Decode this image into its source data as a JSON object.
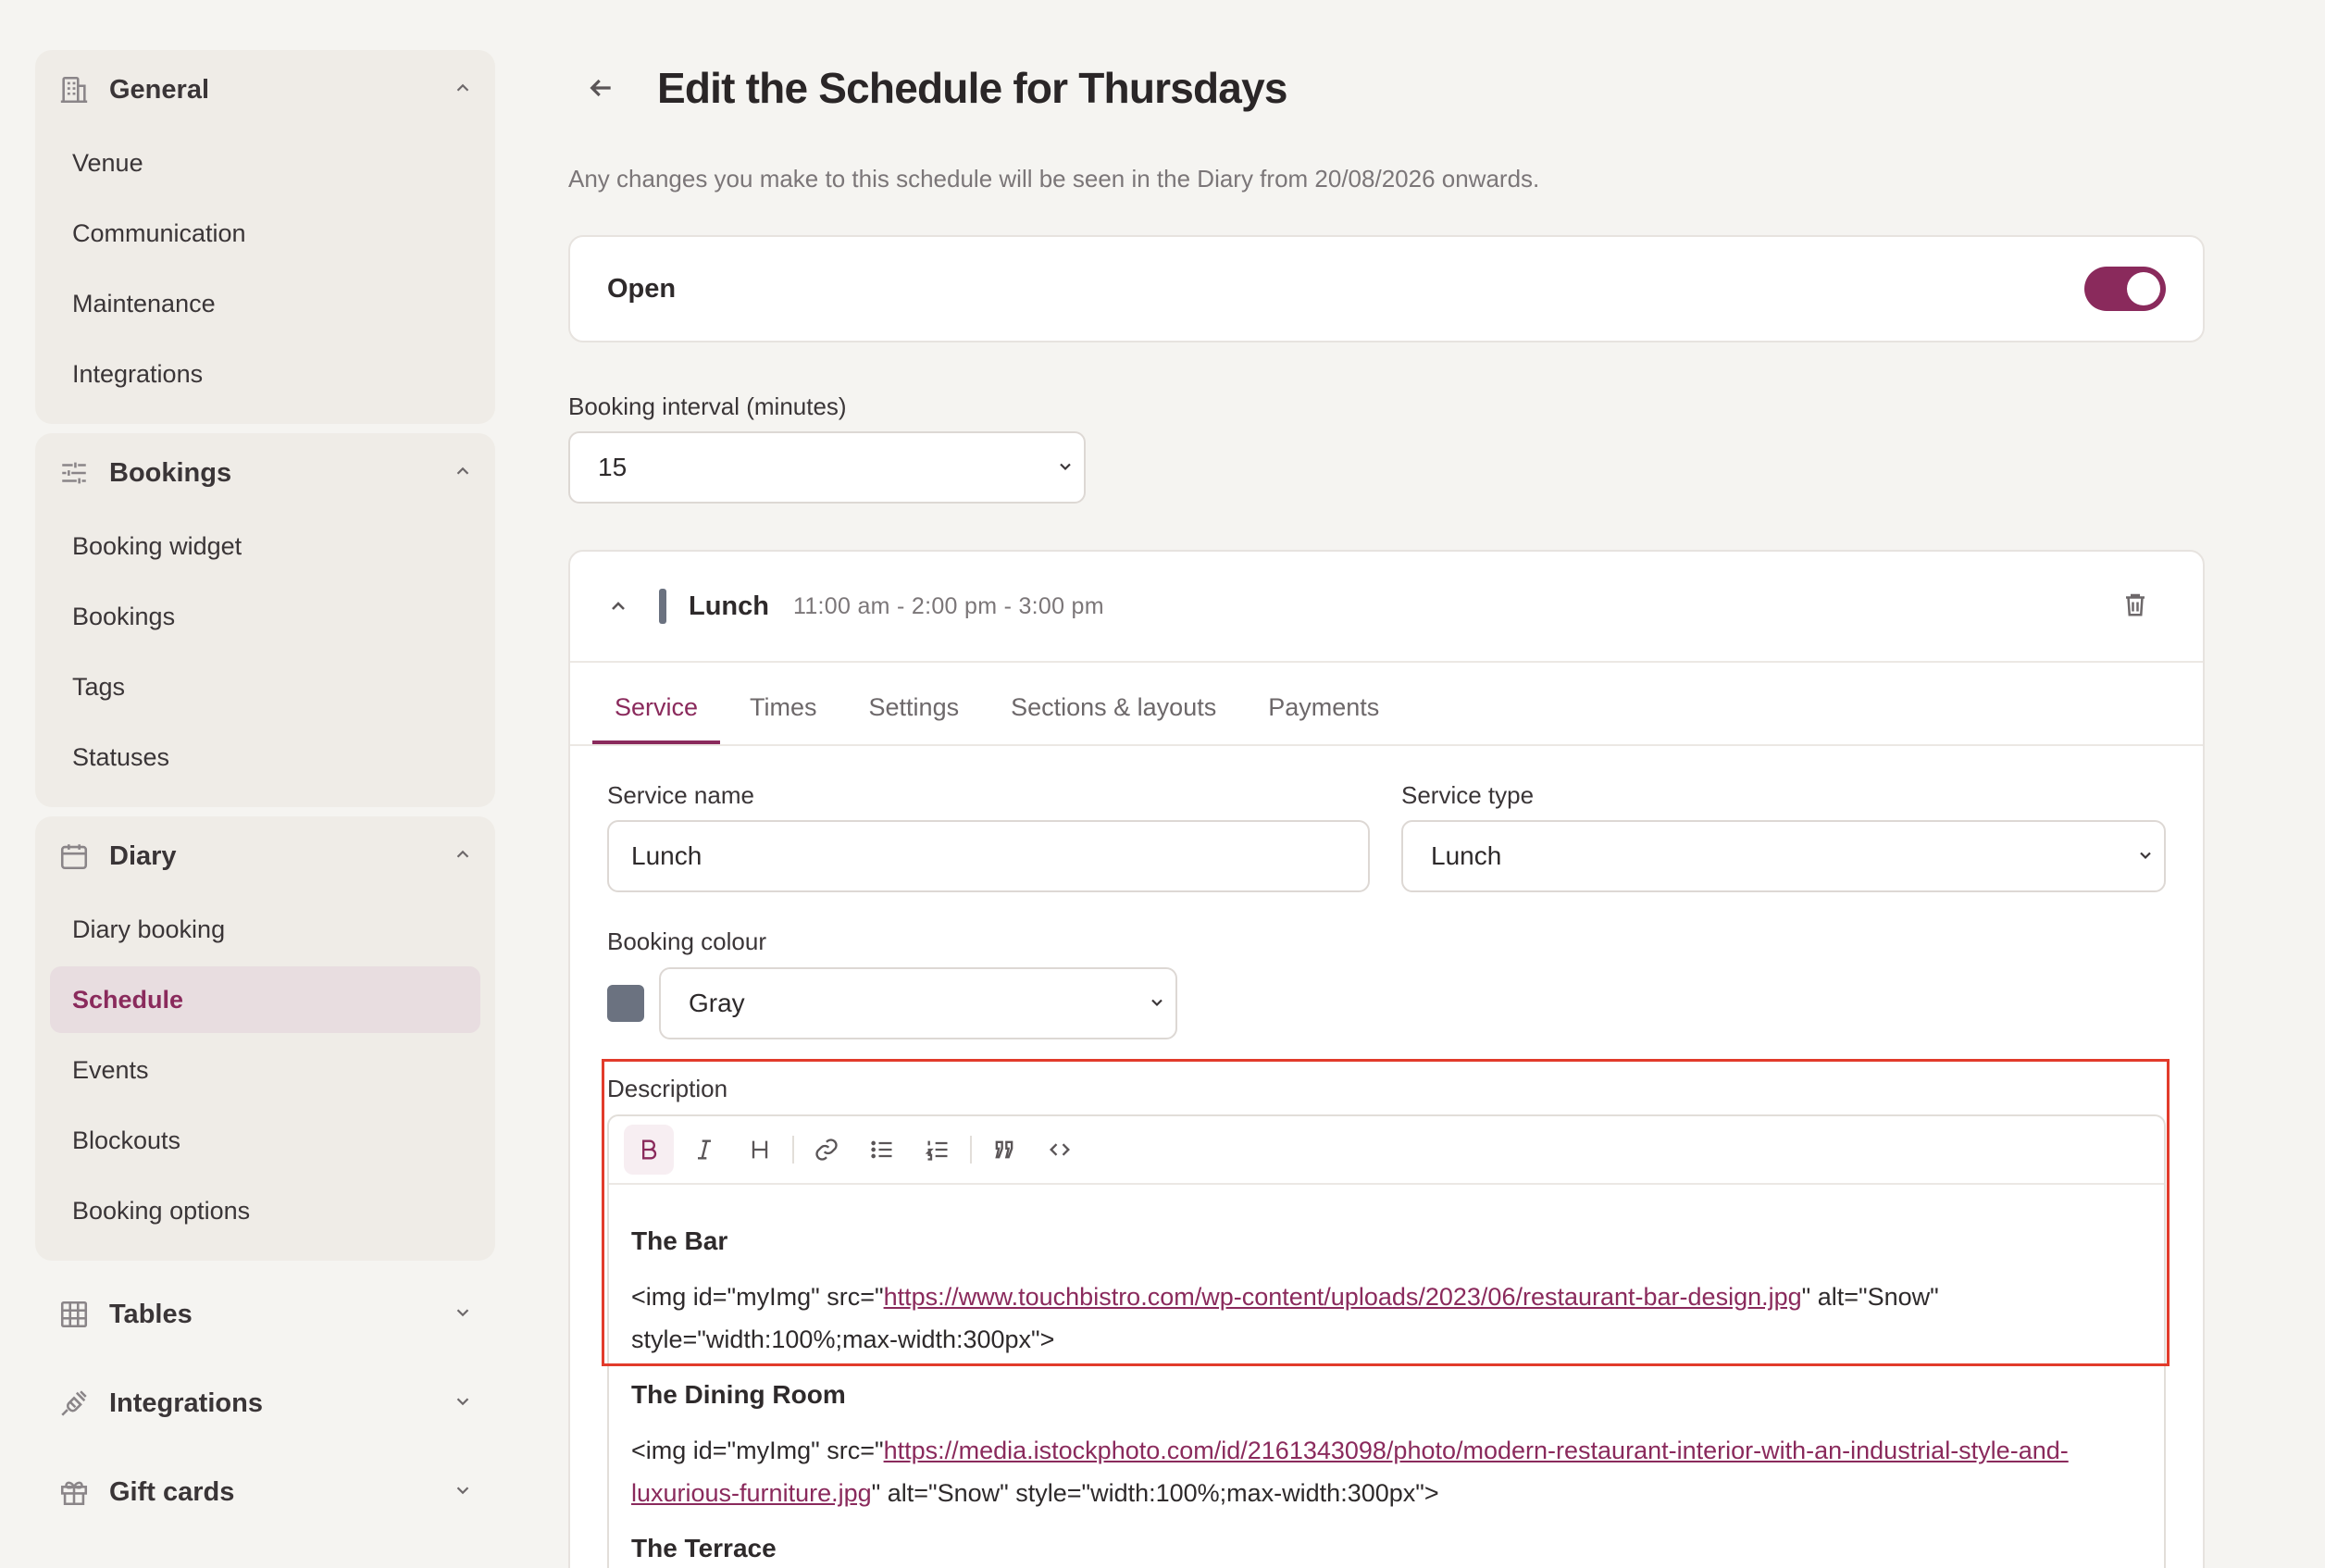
{
  "sidebar": {
    "groups": [
      {
        "title": "General",
        "items": [
          "Venue",
          "Communication",
          "Maintenance",
          "Integrations"
        ]
      },
      {
        "title": "Bookings",
        "items": [
          "Booking widget",
          "Bookings",
          "Tags",
          "Statuses"
        ]
      },
      {
        "title": "Diary",
        "items": [
          "Diary booking",
          "Schedule",
          "Events",
          "Blockouts",
          "Booking options"
        ],
        "active": "Schedule"
      }
    ],
    "collapsed": [
      "Tables",
      "Integrations",
      "Gift cards"
    ]
  },
  "header": {
    "title": "Edit the Schedule for Thursdays",
    "subtitle": "Any changes you make to this schedule will be seen in the Diary from 20/08/2026 onwards."
  },
  "open": {
    "label": "Open",
    "enabled": true
  },
  "booking_interval": {
    "label": "Booking interval (minutes)",
    "value": "15"
  },
  "service": {
    "name": "Lunch",
    "times": "11:00 am - 2:00 pm - 3:00 pm",
    "color": "#6b7280",
    "tabs": [
      "Service",
      "Times",
      "Settings",
      "Sections & layouts",
      "Payments"
    ],
    "active_tab": "Service",
    "service_name_label": "Service name",
    "service_name_value": "Lunch",
    "service_type_label": "Service type",
    "service_type_value": "Lunch",
    "booking_colour_label": "Booking colour",
    "booking_colour_value": "Gray",
    "description_label": "Description"
  },
  "editor": {
    "toolbar": [
      "bold",
      "italic",
      "heading",
      "link",
      "bullet-list",
      "ordered-list",
      "quote",
      "code"
    ],
    "blocks": [
      {
        "heading": "The Bar",
        "pre": "<img id=\"myImg\" src=\"",
        "link": "https://www.touchbistro.com/wp-content/uploads/2023/06/restaurant-bar-design.jpg",
        "post": "\" alt=\"Snow\" style=\"width:100%;max-width:300px\">"
      },
      {
        "heading": "The Dining Room",
        "pre": "<img id=\"myImg\" src=\"",
        "link": "https://media.istockphoto.com/id/2161343098/photo/modern-restaurant-interior-with-an-industrial-style-and-luxurious-furniture.jpg",
        "post": "\" alt=\"Snow\" style=\"width:100%;max-width:300px\">"
      },
      {
        "heading": "The Terrace"
      }
    ]
  },
  "colors": {
    "accent": "#8a2a5c",
    "highlight": "#e23b2b"
  }
}
